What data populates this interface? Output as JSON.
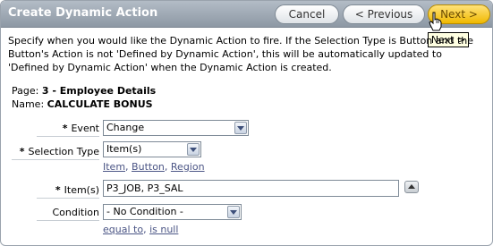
{
  "header": {
    "title": "Create Dynamic Action",
    "cancel_label": "Cancel",
    "previous_label": "< Previous",
    "next_label": "Next >",
    "next_tooltip": "Next >"
  },
  "intro": {
    "text": "Specify when you would like the Dynamic Action to fire. If the Selection Type is Button and the Button's Action is not 'Defined by Dynamic Action', this will be automatically updated to 'Defined by Dynamic Action' when the Dynamic Action is created."
  },
  "info": {
    "page_label": "Page:",
    "page_value": "3 - Employee Details",
    "name_label": "Name:",
    "name_value": "CALCULATE BONUS"
  },
  "form": {
    "event": {
      "required_mark": "*",
      "label": "Event",
      "value": "Change"
    },
    "selection_type": {
      "required_mark": "*",
      "label": "Selection Type",
      "value": "Item(s)",
      "links": [
        "Item",
        "Button",
        "Region"
      ]
    },
    "items": {
      "required_mark": "*",
      "label": "Item(s)",
      "value": "P3_JOB, P3_SAL"
    },
    "condition": {
      "label": "Condition",
      "value": "- No Condition -",
      "links": [
        "equal to",
        "is null"
      ]
    }
  },
  "icons": {
    "cursor": "hand-pointer-icon",
    "dropdown": "chevron-down-icon",
    "move_up": "arrow-up-icon"
  },
  "colors": {
    "header_bg": "#9aa4af",
    "next_button": "#f5c518",
    "tooltip_bg": "#ffffe1",
    "link": "#4b5585"
  }
}
